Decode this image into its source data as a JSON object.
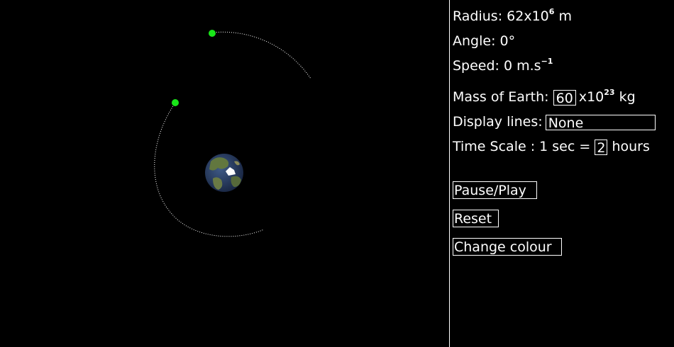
{
  "readouts": {
    "radius_label": "Radius: 62x10",
    "radius_exp": "6",
    "radius_unit": " m",
    "angle": "Angle: 0°",
    "speed_label": "Speed: 0 m.s",
    "speed_exp": "−1"
  },
  "controls": {
    "mass_label": "Mass of Earth:",
    "mass_value": "60",
    "mass_suffix": "x10",
    "mass_exp": "23",
    "mass_unit": " kg",
    "lines_label": "Display lines:",
    "lines_value": "None",
    "timescale_label": "Time Scale : 1 sec =",
    "timescale_value": "2",
    "timescale_unit": "hours"
  },
  "buttons": {
    "pause_play": "Pause/Play",
    "reset": "Reset",
    "change_colour": "Change colour"
  },
  "colors": {
    "satellite": "#19e619",
    "trail": "#ffffff",
    "background": "#000000",
    "earth_ocean": "#2c3f63",
    "earth_land": "#5a7040"
  },
  "scene": {
    "earth_icon": "earth-globe-icon",
    "satellites": 2
  }
}
